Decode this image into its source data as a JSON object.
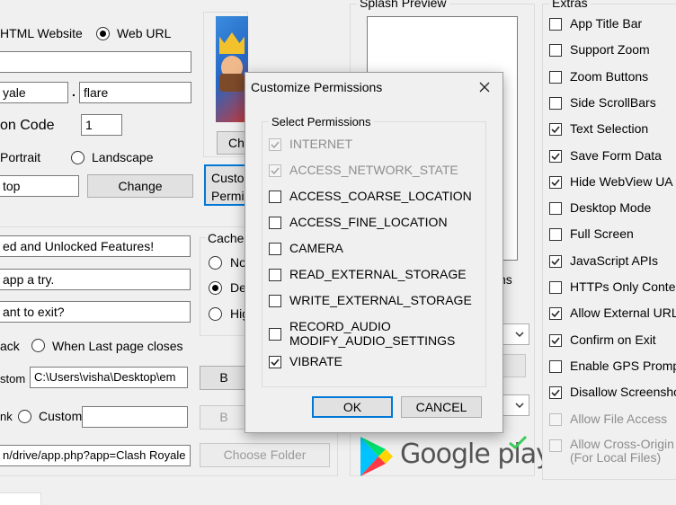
{
  "source": {
    "html_website": "HTML Website",
    "web_url": "Web URL"
  },
  "name": {
    "part1": "yale",
    "part2": "flare",
    "separator": "."
  },
  "version": {
    "label": "on Code",
    "value": "1"
  },
  "orientation": {
    "portrait": "Portrait",
    "landscape": "Landscape"
  },
  "path_field": {
    "value": "top",
    "change_button": "Change"
  },
  "app_icon": {
    "change_button_partial": "Cha"
  },
  "customize_button_partial": {
    "line1": "Custo",
    "line2": "Permi"
  },
  "messages": {
    "field1": "ed and Unlocked Features!",
    "field2": "app a try.",
    "field3": "ant to exit?"
  },
  "back": {
    "label_partial": "ack",
    "option": "When Last page closes"
  },
  "custom_path": {
    "label_partial": "stom",
    "value": "C:\\Users\\visha\\Desktop\\em",
    "button_partial": "B"
  },
  "link": {
    "label_partial": "nk",
    "custom": "Custom",
    "button_partial": "B"
  },
  "url_field": {
    "value": "n/drive/app.php?app=Clash Royale",
    "choose_folder": "Choose Folder"
  },
  "cache": {
    "legend": "Cache",
    "opt1": "No",
    "opt2": "Def",
    "opt3": "Hig"
  },
  "splash": {
    "legend": "Splash Preview",
    "label_partial": "ns"
  },
  "google_play": {
    "text": "Google play"
  },
  "extras": {
    "legend": "Extras",
    "items": [
      {
        "label": "App Title Bar",
        "checked": false,
        "disabled": false
      },
      {
        "label": "Support Zoom",
        "checked": false,
        "disabled": false
      },
      {
        "label": "Zoom Buttons",
        "checked": false,
        "disabled": false
      },
      {
        "label": "Side ScrollBars",
        "checked": false,
        "disabled": false
      },
      {
        "label": "Text Selection",
        "checked": true,
        "disabled": false
      },
      {
        "label": "Save Form Data",
        "checked": true,
        "disabled": false
      },
      {
        "label": "Hide WebView UA",
        "checked": true,
        "disabled": false
      },
      {
        "label": "Desktop Mode",
        "checked": false,
        "disabled": false
      },
      {
        "label": "Full Screen",
        "checked": false,
        "disabled": false
      },
      {
        "label": "JavaScript APIs",
        "checked": true,
        "disabled": false
      },
      {
        "label": "HTTPs Only Content",
        "checked": false,
        "disabled": false
      },
      {
        "label": "Allow External URLs",
        "checked": true,
        "disabled": false
      },
      {
        "label": "Confirm on Exit",
        "checked": true,
        "disabled": false
      },
      {
        "label": "Enable GPS Prompt",
        "checked": false,
        "disabled": false
      },
      {
        "label": "Disallow Screenshot",
        "checked": true,
        "disabled": false
      },
      {
        "label": "Allow File Access",
        "checked": false,
        "disabled": true
      },
      {
        "label": "Allow Cross-Origin",
        "label2": "(For Local Files)",
        "checked": false,
        "disabled": true
      }
    ]
  },
  "dialog": {
    "title": "Customize Permissions",
    "group_legend": "Select Permissions",
    "permissions": [
      {
        "label": "INTERNET",
        "checked": true,
        "disabled": true
      },
      {
        "label": "ACCESS_NETWORK_STATE",
        "checked": true,
        "disabled": true
      },
      {
        "label": "ACCESS_COARSE_LOCATION",
        "checked": false,
        "disabled": false
      },
      {
        "label": "ACCESS_FINE_LOCATION",
        "checked": false,
        "disabled": false
      },
      {
        "label": "CAMERA",
        "checked": false,
        "disabled": false
      },
      {
        "label": "READ_EXTERNAL_STORAGE",
        "checked": false,
        "disabled": false
      },
      {
        "label": "WRITE_EXTERNAL_STORAGE",
        "checked": false,
        "disabled": false
      },
      {
        "label": "RECORD_AUDIO",
        "label2": "MODIFY_AUDIO_SETTINGS",
        "checked": false,
        "disabled": false
      },
      {
        "label": "VIBRATE",
        "checked": true,
        "disabled": false
      }
    ],
    "ok": "OK",
    "cancel": "CANCEL"
  },
  "colors": {
    "accent": "#0078d7",
    "window_bg": "#f0f0f0",
    "google_play_green": "#3bcc5a"
  }
}
